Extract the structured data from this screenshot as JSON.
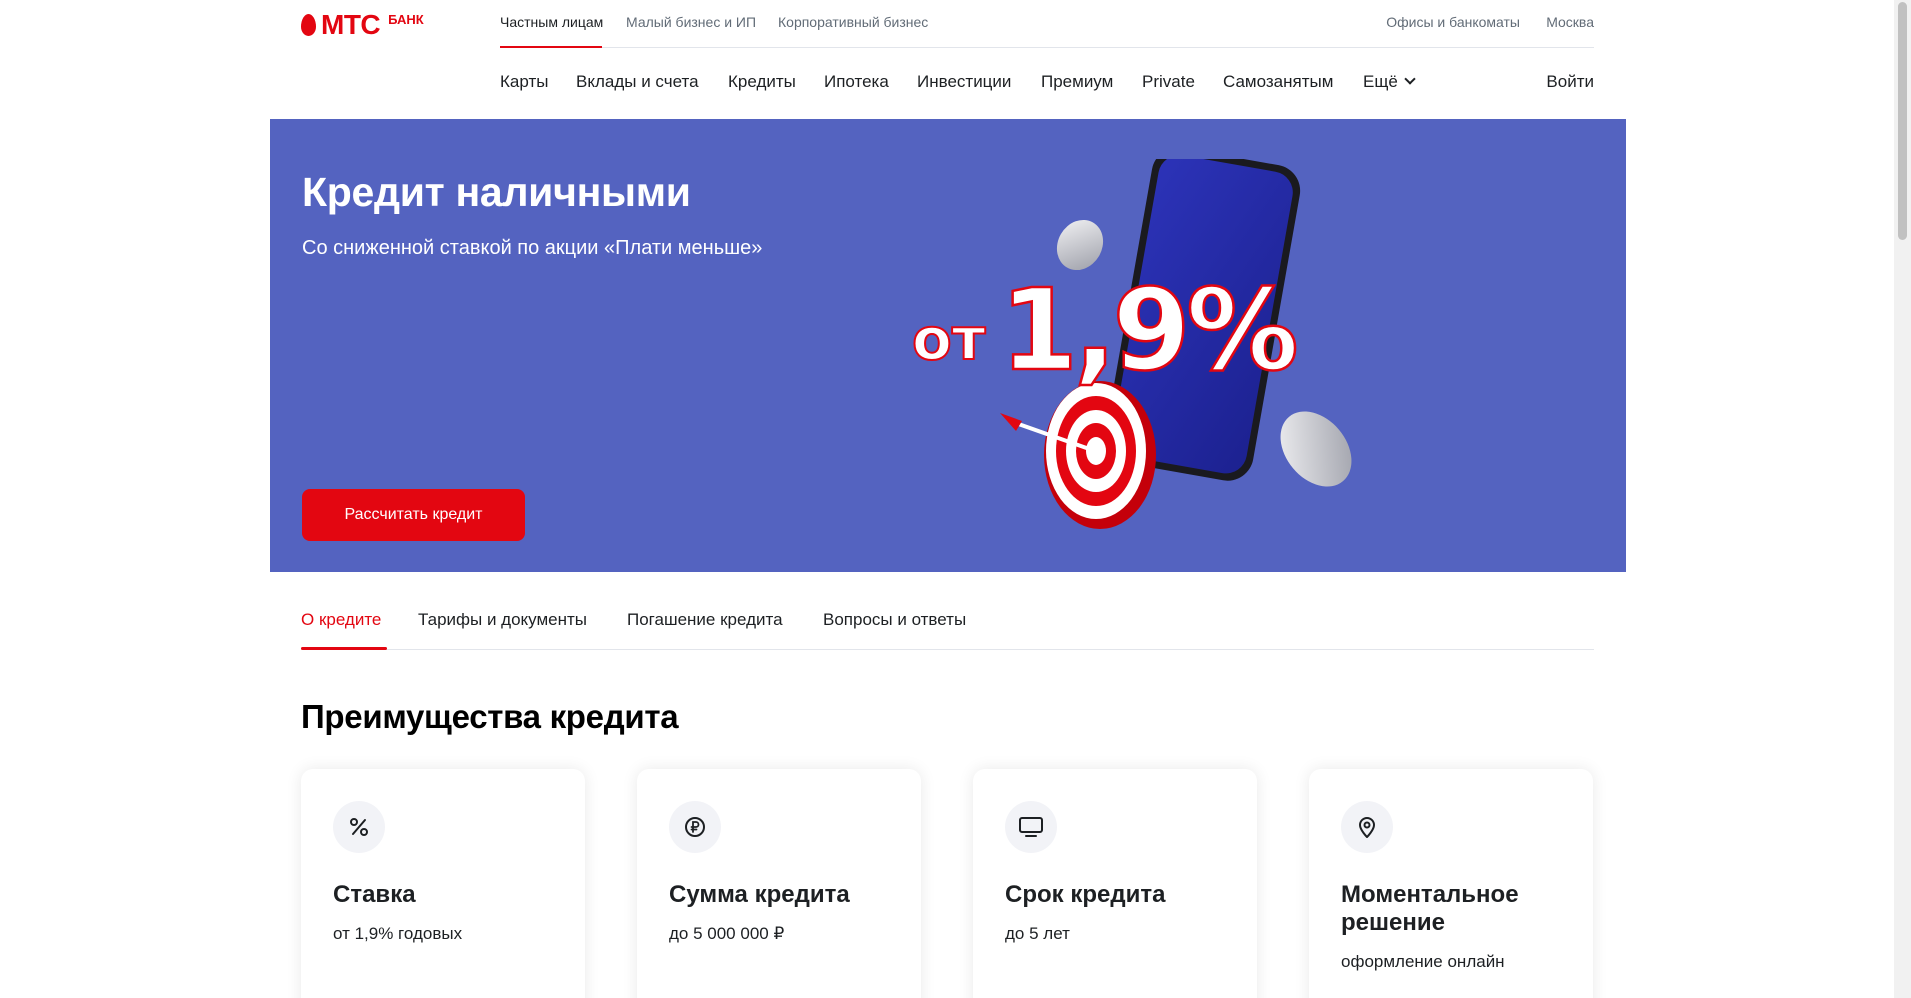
{
  "brand": {
    "name": "МТС",
    "sub": "БАНК",
    "color": "#e30611"
  },
  "topnav": {
    "segments": [
      "Частным лицам",
      "Малый бизнес и ИП",
      "Корпоративный бизнес"
    ],
    "offices": "Офисы и банкоматы",
    "city": "Москва"
  },
  "mainnav": {
    "items": [
      "Карты",
      "Вклады и счета",
      "Кредиты",
      "Ипотека",
      "Инвестиции",
      "Премиум",
      "Private",
      "Самозанятым",
      "Ещё"
    ],
    "login": "Войти"
  },
  "hero": {
    "title": "Кредит наличными",
    "subtitle": "Со сниженной ставкой по акции «Плати меньше»",
    "cta": "Рассчитать кредит",
    "promo_prefix": "от",
    "promo_rate": "1,9%",
    "background": "#5463c0"
  },
  "tabs": [
    "О кредите",
    "Тарифы и документы",
    "Погашение кредита",
    "Вопросы и ответы"
  ],
  "advantages": {
    "title": "Преимущества кредита",
    "cards": [
      {
        "icon": "percent-icon",
        "title": "Ставка",
        "desc": "от 1,9% годовых"
      },
      {
        "icon": "ruble-coin-icon",
        "title": "Сумма кредита",
        "desc": "до 5 000 000 ₽"
      },
      {
        "icon": "monitor-icon",
        "title": "Срок кредита",
        "desc": "до 5 лет"
      },
      {
        "icon": "location-pin-icon",
        "title": "Моментальное решение",
        "desc": "оформление онлайн"
      }
    ]
  }
}
